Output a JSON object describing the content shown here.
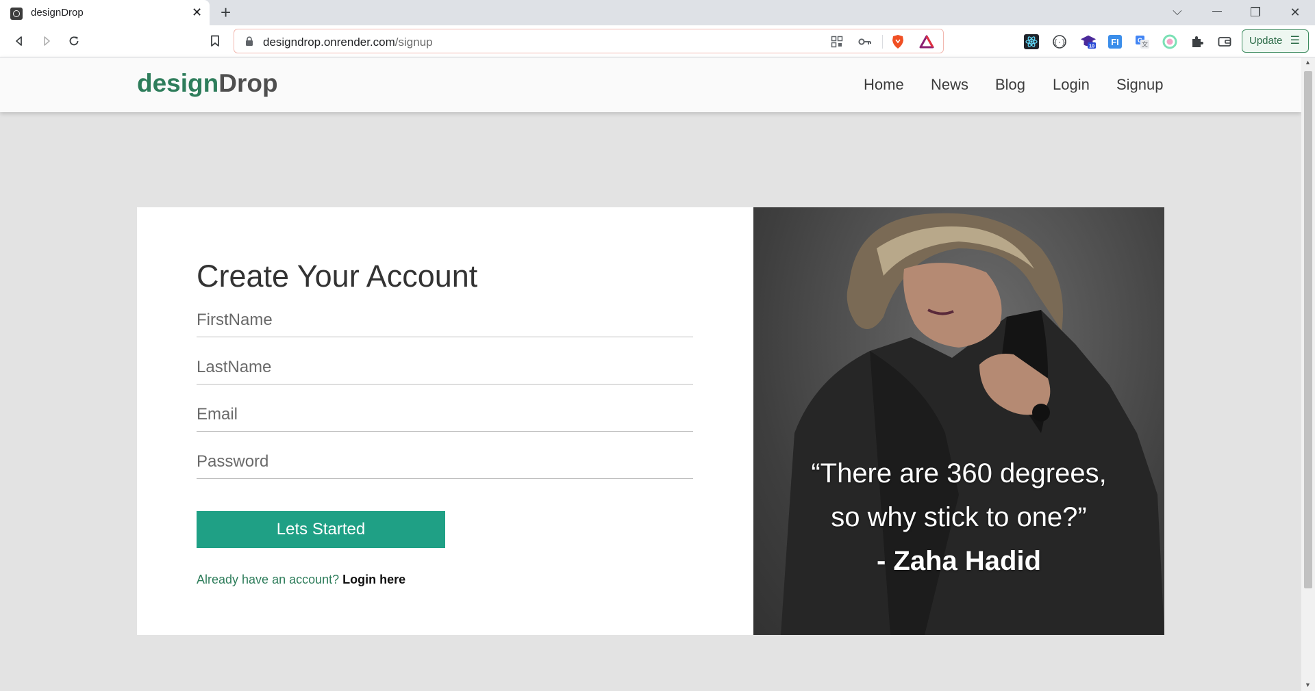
{
  "browser": {
    "tab_title": "designDrop",
    "tab_close": "✕",
    "new_tab": "+",
    "url_host": "designdrop.onrender.com",
    "url_path": "/signup",
    "update_label": "Update",
    "update_menu": "☰",
    "window_controls": {
      "tab_list": "⌵",
      "minimize": "—",
      "restore": "❐",
      "close": "✕"
    }
  },
  "site": {
    "logo_part1": "design",
    "logo_part2": "Drop",
    "nav": [
      "Home",
      "News",
      "Blog",
      "Login",
      "Signup"
    ]
  },
  "signup": {
    "title": "Create Your Account",
    "fields": {
      "first_name": {
        "placeholder": "FirstName",
        "value": ""
      },
      "last_name": {
        "placeholder": "LastName",
        "value": ""
      },
      "email": {
        "placeholder": "Email",
        "value": ""
      },
      "password": {
        "placeholder": "Password",
        "value": ""
      }
    },
    "submit_label": "Lets Started",
    "login_question": "Already have an account?",
    "login_link": "Login here"
  },
  "hero": {
    "quote_line1": "“There are 360 degrees,",
    "quote_line2": "so why stick to one?”",
    "author": "- Zaha Hadid"
  },
  "colors": {
    "brand_green": "#2e7d5b",
    "button_teal": "#1fa085",
    "page_bg": "#e3e3e3"
  }
}
